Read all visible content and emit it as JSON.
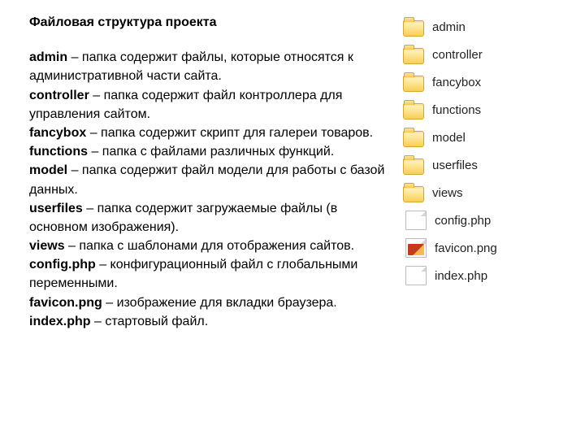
{
  "heading": "Файловая структура проекта",
  "entries": [
    {
      "name": "admin",
      "desc": " – папка содержит файлы, которые относятся к административной части сайта."
    },
    {
      "name": "controller",
      "desc": " – папка содержит файл контроллера для управления сайтом."
    },
    {
      "name": "fancybox",
      "desc": " – папка содержит скрипт для галереи товаров."
    },
    {
      "name": "functions",
      "desc": " – папка с файлами различных функций."
    },
    {
      "name": "model",
      "desc": " – папка содержит файл модели для работы с базой данных."
    },
    {
      "name": "userfiles",
      "desc": " – папка содержит загружаемые файлы (в основном изображения)."
    },
    {
      "name": "views",
      "desc": " – папка с шаблонами для отображения сайтов."
    },
    {
      "name": "config.php",
      "desc": " – конфигурационный файл с глобальными переменными."
    },
    {
      "name": "favicon.png",
      "desc": " – изображение для вкладки браузера."
    },
    {
      "name": "index.php",
      "desc": " – стартовый файл."
    }
  ],
  "file_listing": [
    {
      "label": "admin",
      "icon": "folder"
    },
    {
      "label": "controller",
      "icon": "folder"
    },
    {
      "label": "fancybox",
      "icon": "folder"
    },
    {
      "label": "functions",
      "icon": "folder"
    },
    {
      "label": "model",
      "icon": "folder"
    },
    {
      "label": "userfiles",
      "icon": "folder"
    },
    {
      "label": "views",
      "icon": "folder"
    },
    {
      "label": "config.php",
      "icon": "file"
    },
    {
      "label": "favicon.png",
      "icon": "png"
    },
    {
      "label": "index.php",
      "icon": "file"
    }
  ]
}
